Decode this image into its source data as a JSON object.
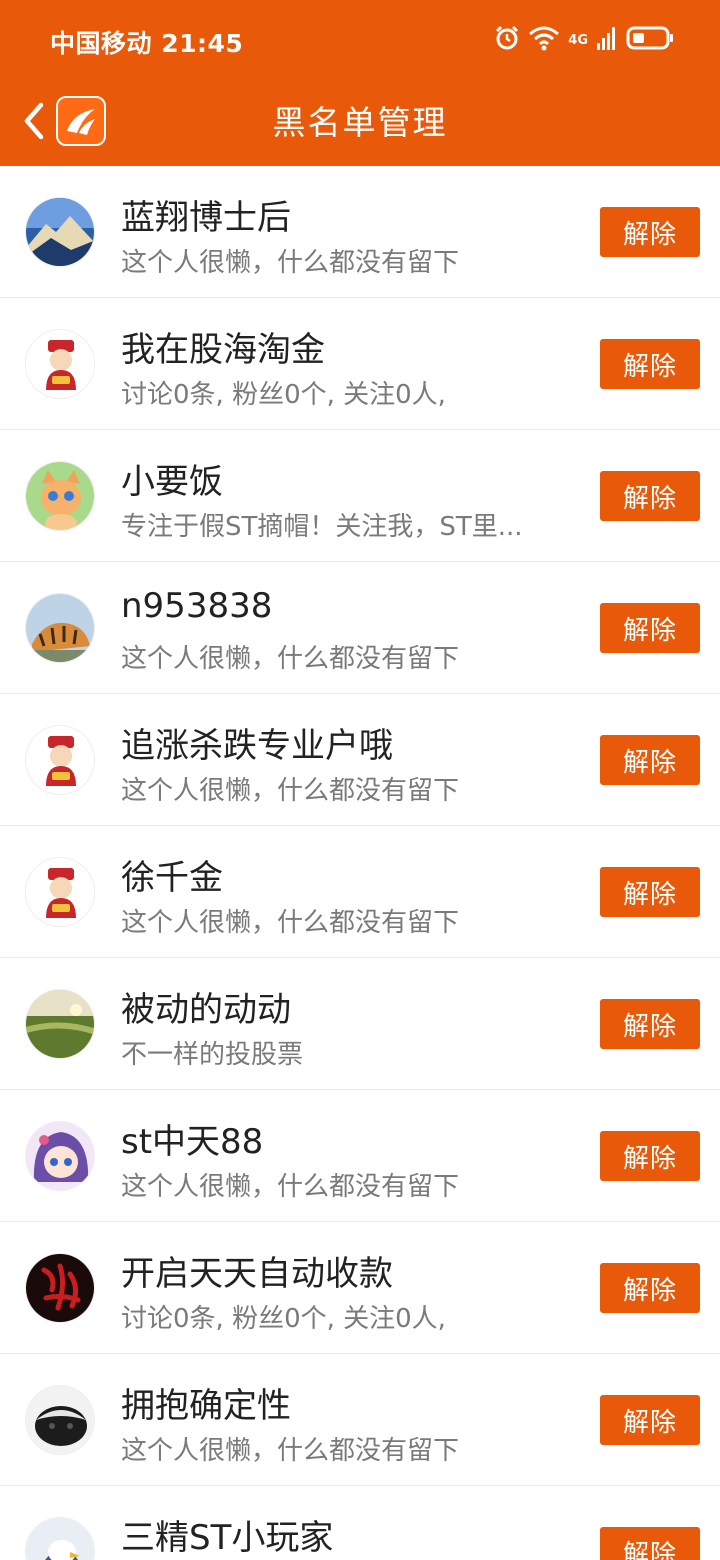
{
  "status_bar": {
    "carrier": "中国移动",
    "time": "21:45",
    "network": "4G",
    "icons": [
      "alarm-icon",
      "wifi-icon",
      "signal-icon",
      "battery-icon"
    ]
  },
  "header": {
    "title": "黑名单管理",
    "back_icon": "chevron-left-icon",
    "logo_icon": "app-logo-icon"
  },
  "colors": {
    "brand": "#e85a0a",
    "text_primary": "#222222",
    "text_secondary": "#7a7a7a",
    "divider": "#ebebeb"
  },
  "list": {
    "items": [
      {
        "name": "蓝翔博士后",
        "desc": "这个人很懒，什么都没有留下",
        "avatar": "mountain-avatar",
        "action": "解除"
      },
      {
        "name": "我在股海淘金",
        "desc": "讨论0条, 粉丝0个, 关注0人,",
        "avatar": "fortune-god-avatar",
        "action": "解除"
      },
      {
        "name": "小要饭",
        "desc": "专注于假ST摘帽！关注我，ST里...",
        "avatar": "kitten-avatar",
        "action": "解除"
      },
      {
        "name": "n953838",
        "desc": "这个人很懒，什么都没有留下",
        "avatar": "tiger-avatar",
        "action": "解除"
      },
      {
        "name": "追涨杀跌专业户哦",
        "desc": "这个人很懒，什么都没有留下",
        "avatar": "fortune-god-avatar",
        "action": "解除"
      },
      {
        "name": "徐千金",
        "desc": "这个人很懒，什么都没有留下",
        "avatar": "fortune-god-avatar",
        "action": "解除"
      },
      {
        "name": "被动的动动",
        "desc": "不一样的投股票",
        "avatar": "field-avatar",
        "action": "解除"
      },
      {
        "name": "st中天88",
        "desc": "这个人很懒，什么都没有留下",
        "avatar": "anime-girl-avatar",
        "action": "解除"
      },
      {
        "name": "开启天天自动收款",
        "desc": "讨论0条, 粉丝0个, 关注0人,",
        "avatar": "red-calligraphy-avatar",
        "action": "解除"
      },
      {
        "name": "拥抱确定性",
        "desc": "这个人很懒，什么都没有留下",
        "avatar": "badger-avatar",
        "action": "解除"
      },
      {
        "name": "三精ST小玩家",
        "desc": "",
        "avatar": "eagle-avatar",
        "action": "解除"
      }
    ]
  }
}
